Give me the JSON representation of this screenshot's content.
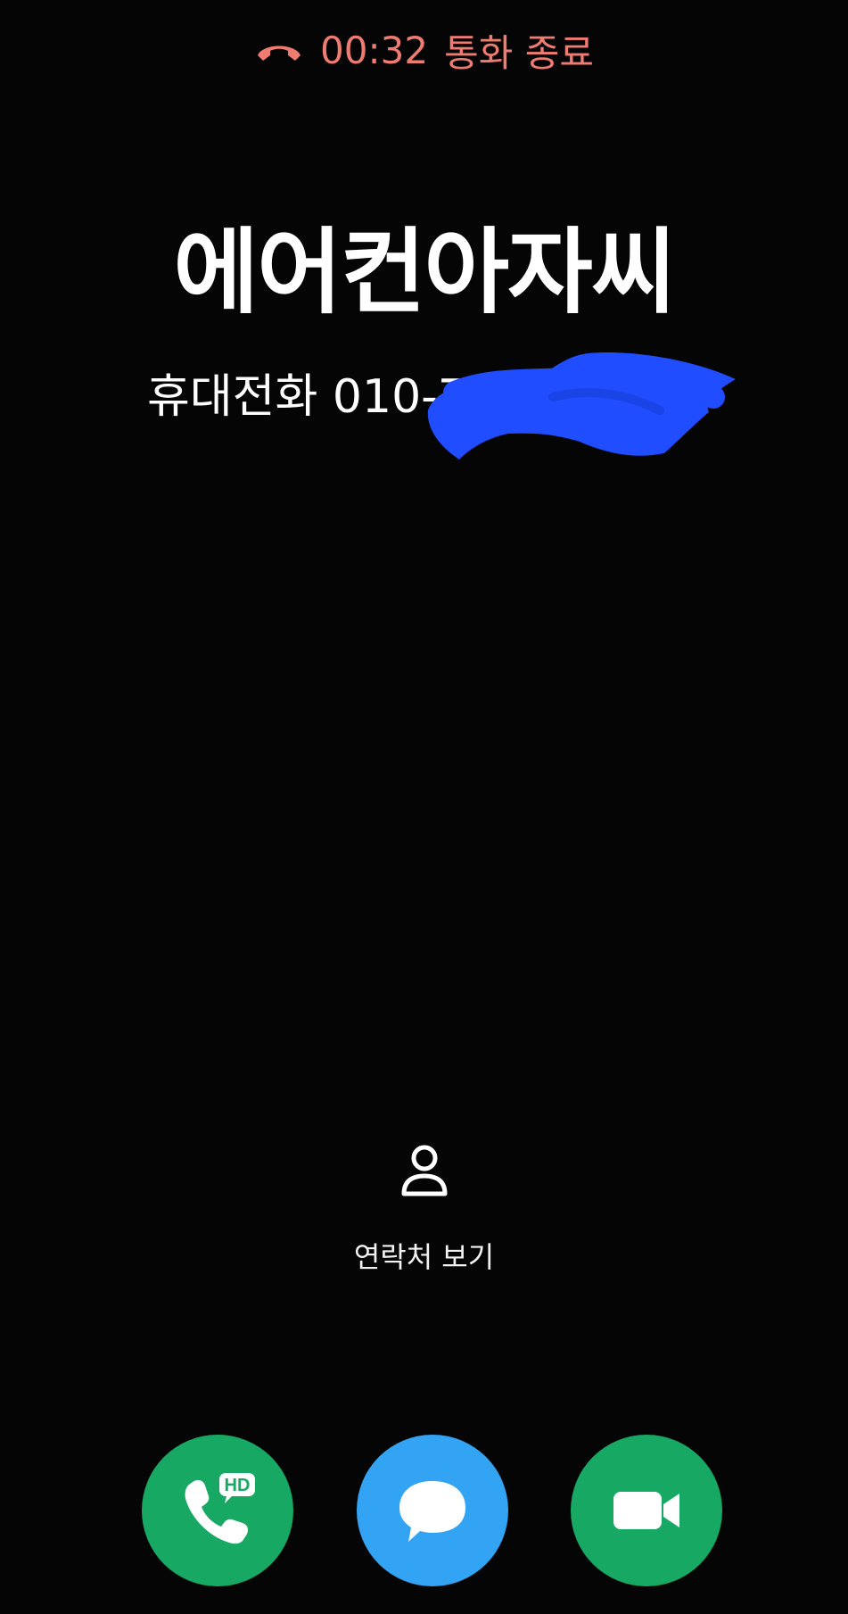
{
  "status": {
    "timer": "00:32",
    "label": "통화 종료",
    "color": "#f07b70",
    "icon": "call-end-icon"
  },
  "caller": {
    "name": "에어컨아자씨",
    "number_type": "휴대전화",
    "number_visible": "010-76",
    "redaction_color": "#1f4dff"
  },
  "contact_link": {
    "label": "연락처 보기",
    "icon": "person-icon"
  },
  "actions": [
    {
      "name": "hd-voice-call",
      "icon": "hd-phone-icon",
      "badge": "HD",
      "color": "#17a864"
    },
    {
      "name": "message",
      "icon": "chat-bubble-icon",
      "color": "#33a3f3"
    },
    {
      "name": "video-call",
      "icon": "video-camera-icon",
      "color": "#17a864"
    }
  ],
  "colors": {
    "background": "#050505",
    "text": "#ffffff"
  }
}
